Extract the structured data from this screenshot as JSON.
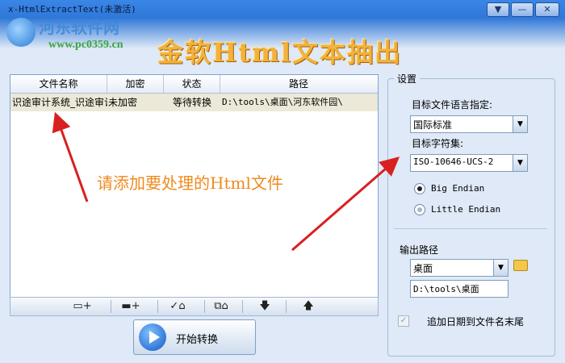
{
  "window": {
    "title": "x-HtmlExtractText(未激活)",
    "min_glyph": "▼",
    "close_glyph": "—",
    "x_glyph": "✕"
  },
  "watermark": {
    "name": "河东软件网",
    "url": "www.pc0359.cn"
  },
  "banner": {
    "title": "金软Html文本抽出"
  },
  "table": {
    "columns": [
      "文件名称",
      "加密",
      "状态",
      "路径"
    ],
    "rows": [
      {
        "name": "识途审计系统_识途审计",
        "encryption": "未加密",
        "status": "等待转换",
        "path": "D:\\tools\\桌面\\河东软件园\\"
      }
    ]
  },
  "hint": "请添加要处理的Html文件",
  "toolbar": {
    "add_file_icon": "add-file-icon",
    "add_folder_icon": "add-folder-icon",
    "remove_checked_icon": "remove-checked-icon",
    "remove_all_icon": "remove-all-icon",
    "move_down_icon": "move-down-icon",
    "move_up_icon": "move-up-icon"
  },
  "start_button": {
    "label": "开始转换"
  },
  "settings": {
    "title": "设置",
    "language_label": "目标文件语言指定:",
    "language_value": "国际标准",
    "charset_label": "目标字符集:",
    "charset_value": "ISO-10646-UCS-2",
    "big_endian": "Big Endian",
    "little_endian": "Little Endian",
    "output_label": "输出路径",
    "output_combo": "桌面",
    "output_path": "D:\\tools\\桌面",
    "append_date": "追加日期到文件名末尾"
  },
  "colors": {
    "hint": "#f08a1e",
    "arrow": "#d92020",
    "banner": "#f2b23b"
  }
}
